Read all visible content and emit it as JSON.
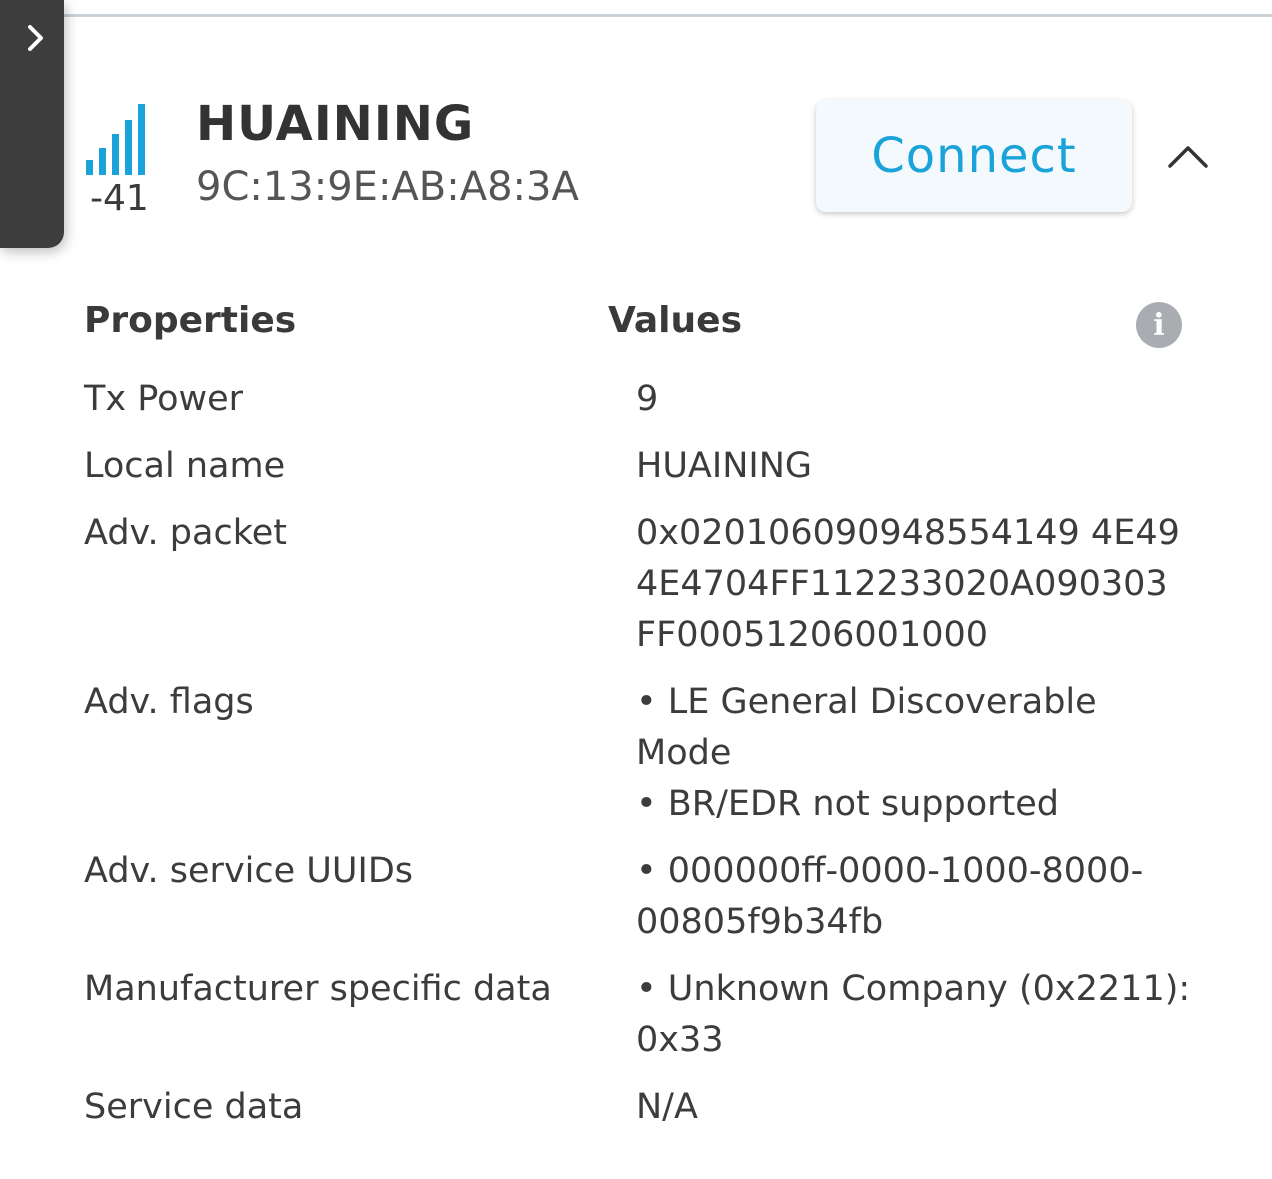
{
  "device": {
    "name": "HUAINING",
    "mac": "9C:13:9E:AB:A8:3A",
    "rssi": "-41",
    "signal_icon": "signal-strength-bars-icon",
    "signal_color": "#1aa3d9",
    "connect_label": "Connect"
  },
  "table": {
    "properties_header": "Properties",
    "values_header": "Values",
    "info_glyph": "i"
  },
  "rows": {
    "tx_power": {
      "label": "Tx Power",
      "value": "9"
    },
    "local_name": {
      "label": "Local name",
      "value": "HUAINING"
    },
    "adv_packet": {
      "label": "Adv. packet",
      "lines": [
        "0x020106090948554149 4E49",
        "4E4704FF112233020A090303",
        "FF00051206001000"
      ]
    },
    "adv_flags": {
      "label": "Adv. flags",
      "lines": [
        "• LE General Discoverable",
        "Mode",
        "• BR/EDR not supported"
      ]
    },
    "adv_service_uuids": {
      "label": "Adv. service UUIDs",
      "lines": [
        "• 000000ff-0000-1000-8000-",
        "00805f9b34fb"
      ]
    },
    "manufacturer_data": {
      "label": "Manufacturer specific data",
      "lines": [
        "• Unknown Company (0x2211):",
        "0x33"
      ]
    },
    "service_data": {
      "label": "Service data",
      "value": "N/A"
    }
  },
  "colors": {
    "accent": "#1aa3d9",
    "side_toggle": "#3d3d3d",
    "info_icon": "#a9adb1"
  }
}
